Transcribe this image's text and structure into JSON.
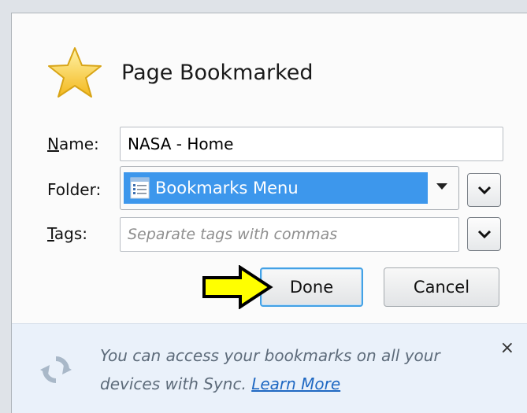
{
  "dialog": {
    "title": "Page Bookmarked",
    "name_label": "Name:",
    "name_value": "NASA - Home",
    "folder_label": "Folder:",
    "folder_value": "Bookmarks Menu",
    "tags_label": "Tags:",
    "tags_placeholder": "Separate tags with commas",
    "done_label": "Done",
    "cancel_label": "Cancel"
  },
  "footer": {
    "message": "You can access your bookmarks on all your devices with Sync.",
    "link": "Learn More",
    "close": "×"
  },
  "colors": {
    "accent": "#3d97ec",
    "star": "#f7c530",
    "arrow": "#ffff00",
    "footer_bg": "#eaf1fa"
  },
  "icons": [
    "star-icon",
    "menu-list-icon",
    "chevron-down-icon",
    "sync-icon",
    "close-icon",
    "pointer-arrow-icon"
  ]
}
